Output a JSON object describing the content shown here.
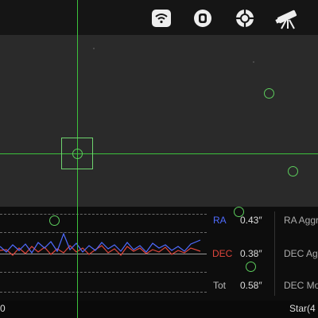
{
  "toolbar": {
    "icons": [
      "wifi-icon",
      "camera-connect-icon",
      "target-icon",
      "telescope-icon"
    ]
  },
  "stats": {
    "ra_label": "RA",
    "ra_value": "0.43″",
    "dec_label": "DEC",
    "dec_value": "0.38″",
    "tot_label": "Tot",
    "tot_value": "0.58″"
  },
  "side": {
    "ra_aggr": "RA Aggr",
    "dec_ag": "DEC Ag",
    "dec_mo": "DEC Mo"
  },
  "footer": {
    "left": "0",
    "right": "Star(4"
  },
  "colors": {
    "ra": "#4f6bff",
    "dec": "#e0463c",
    "guide": "#3cc23c"
  }
}
